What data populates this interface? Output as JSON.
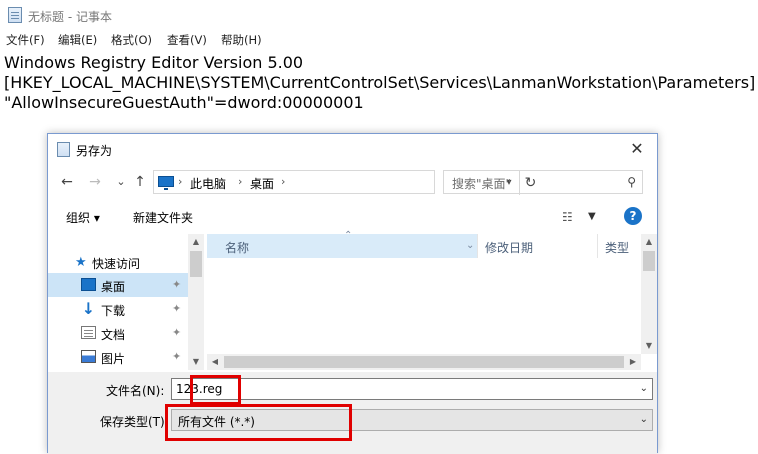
{
  "notepad": {
    "title": "无标题 - 记事本",
    "menu": [
      "文件(F)",
      "编辑(E)",
      "格式(O)",
      "查看(V)",
      "帮助(H)"
    ],
    "content_lines": [
      "Windows Registry Editor Version 5.00",
      "[HKEY_LOCAL_MACHINE\\SYSTEM\\CurrentControlSet\\Services\\LanmanWorkstation\\Parameters]",
      "\"AllowInsecureGuestAuth\"=dword:00000001"
    ]
  },
  "dialog": {
    "title": "另存为",
    "close_glyph": "✕",
    "nav": {
      "back": "←",
      "forward": "→",
      "recent": "⌄",
      "up": "↑"
    },
    "address": {
      "segments": [
        "此电脑",
        "桌面"
      ],
      "separator": "›"
    },
    "search_placeholder": "搜索\"桌面\"",
    "toolbar": {
      "organize": "组织 ▾",
      "new_folder": "新建文件夹",
      "help": "?"
    },
    "nav_pane": {
      "quick_access": "快速访问",
      "items": [
        {
          "label": "桌面",
          "icon": "desktop-icon",
          "selected": true
        },
        {
          "label": "下载",
          "icon": "download-icon",
          "selected": false
        },
        {
          "label": "文档",
          "icon": "document-icon",
          "selected": false
        },
        {
          "label": "图片",
          "icon": "picture-icon",
          "selected": false
        }
      ]
    },
    "columns": {
      "name": "名称",
      "date": "修改日期",
      "type": "类型"
    },
    "form": {
      "filename_label": "文件名(N):",
      "filename_value": "123.reg",
      "filetype_label": "保存类型(T):",
      "filetype_value": "所有文件  (*.*)"
    }
  },
  "colors": {
    "highlight": "#e00000",
    "accent": "#1a73c8",
    "selected_row": "#cce4f7"
  }
}
